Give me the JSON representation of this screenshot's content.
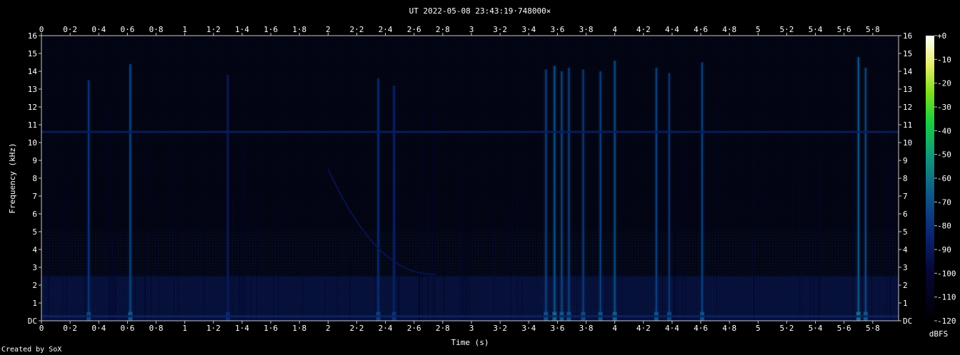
{
  "chart_data": {
    "type": "heatmap",
    "title": "UT 2022-05-08 23:43:19·748000×",
    "xlabel": "Time (s)",
    "ylabel": "Frequency (kHz)",
    "xlim": [
      0,
      5.98
    ],
    "ylim": [
      0,
      16
    ],
    "x_ticks": [
      "0",
      "0·2",
      "0·4",
      "0·6",
      "0·8",
      "1",
      "1·2",
      "1·4",
      "1·6",
      "1·8",
      "2",
      "2·2",
      "2·4",
      "2·6",
      "2·8",
      "3",
      "3·2",
      "3·4",
      "3·6",
      "3·8",
      "4",
      "4·2",
      "4·4",
      "4·6",
      "4·8",
      "5",
      "5·2",
      "5·4",
      "5·6",
      "5·8"
    ],
    "x_tick_values": [
      0,
      0.2,
      0.4,
      0.6,
      0.8,
      1,
      1.2,
      1.4,
      1.6,
      1.8,
      2,
      2.2,
      2.4,
      2.6,
      2.8,
      3,
      3.2,
      3.4,
      3.6,
      3.8,
      4,
      4.2,
      4.4,
      4.6,
      4.8,
      5,
      5.2,
      5.4,
      5.6,
      5.8
    ],
    "y_ticks": [
      "DC",
      "1",
      "2",
      "3",
      "4",
      "5",
      "6",
      "7",
      "8",
      "9",
      "10",
      "11",
      "12",
      "13",
      "14",
      "15",
      "16"
    ],
    "colorbar": {
      "label": "dBFS",
      "ticks": [
        "+0",
        "-10",
        "-20",
        "-30",
        "-40",
        "-50",
        "-60",
        "-70",
        "-80",
        "-90",
        "-100",
        "-110",
        "-120"
      ],
      "range": [
        -120,
        0
      ]
    },
    "tone_khz": 10.6,
    "chirp": {
      "t_start": 2.0,
      "t_end": 2.75,
      "f_start_khz": 8.5,
      "f_end_khz": 2.6
    },
    "events": [
      {
        "t": 0.33,
        "f_top": 13.5,
        "level": -78
      },
      {
        "t": 0.62,
        "f_top": 14.4,
        "level": -72
      },
      {
        "t": 1.3,
        "f_top": 13.8,
        "level": -88
      },
      {
        "t": 2.35,
        "f_top": 13.6,
        "level": -80
      },
      {
        "t": 2.46,
        "f_top": 13.2,
        "level": -84
      },
      {
        "t": 3.52,
        "f_top": 14.1,
        "level": -74
      },
      {
        "t": 3.58,
        "f_top": 14.3,
        "level": -68
      },
      {
        "t": 3.63,
        "f_top": 14.0,
        "level": -72
      },
      {
        "t": 3.68,
        "f_top": 14.2,
        "level": -74
      },
      {
        "t": 3.78,
        "f_top": 14.1,
        "level": -76
      },
      {
        "t": 3.9,
        "f_top": 14.0,
        "level": -74
      },
      {
        "t": 4.0,
        "f_top": 14.6,
        "level": -70
      },
      {
        "t": 4.29,
        "f_top": 14.2,
        "level": -74
      },
      {
        "t": 4.38,
        "f_top": 13.9,
        "level": -78
      },
      {
        "t": 4.61,
        "f_top": 14.5,
        "level": -74
      },
      {
        "t": 5.7,
        "f_top": 14.8,
        "level": -66
      },
      {
        "t": 5.75,
        "f_top": 14.2,
        "level": -72
      }
    ]
  },
  "footer": {
    "credit": "Created by SoX"
  }
}
